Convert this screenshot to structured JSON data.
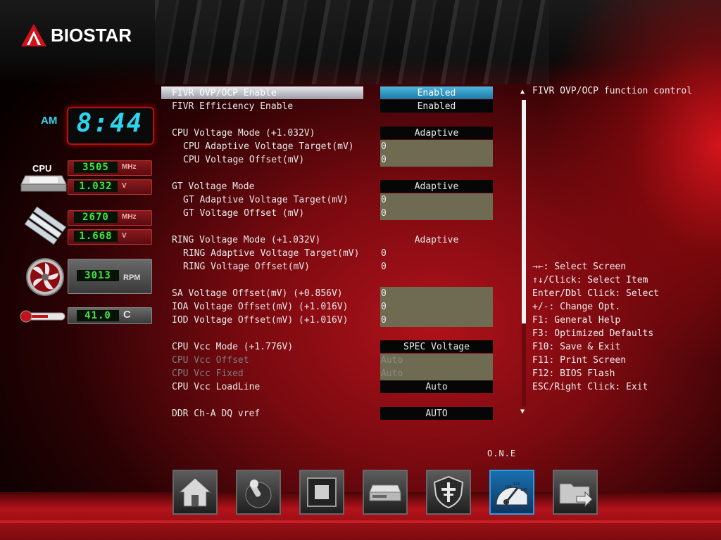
{
  "brand": {
    "name": "BIOSTAR"
  },
  "monitor": {
    "clock": {
      "ampm": "AM",
      "time": "8:44"
    },
    "cpu": {
      "label": "CPU",
      "freq": "3505",
      "freq_unit": "MHz",
      "voltage": "1.032",
      "voltage_unit": "V"
    },
    "memory": {
      "freq": "2670",
      "freq_unit": "MHz",
      "voltage": "1.668",
      "voltage_unit": "V"
    },
    "fan": {
      "speed": "3013",
      "unit": "RPM"
    },
    "temp": {
      "value": "41.0",
      "unit": "C"
    }
  },
  "settings": [
    {
      "label": "FIVR OVP/OCP Enable",
      "value": "Enabled"
    },
    {
      "label": "FIVR Efficiency Enable",
      "value": "Enabled"
    },
    {
      "label": "CPU Voltage Mode (+1.032V)",
      "value": "Adaptive"
    },
    {
      "label": "CPU Adaptive Voltage Target(mV)",
      "value": "0"
    },
    {
      "label": "CPU Voltage Offset(mV)",
      "value": "0"
    },
    {
      "label": "GT Voltage Mode",
      "value": "Adaptive"
    },
    {
      "label": "GT Adaptive Voltage Target(mV)",
      "value": "0"
    },
    {
      "label": "GT Voltage Offset (mV)",
      "value": "0"
    },
    {
      "label": "RING Voltage Mode (+1.032V)",
      "value": "Adaptive"
    },
    {
      "label": "RING Adaptive Voltage Target(mV)",
      "value": "0"
    },
    {
      "label": "RING Voltage Offset(mV)",
      "value": "0"
    },
    {
      "label": "SA Voltage Offset(mV) (+0.856V)",
      "value": "0"
    },
    {
      "label": "IOA Voltage Offset(mV) (+1.016V)",
      "value": "0"
    },
    {
      "label": "IOD Voltage Offset(mV) (+1.016V)",
      "value": "0"
    },
    {
      "label": "CPU Vcc Mode (+1.776V)",
      "value": "SPEC Voltage"
    },
    {
      "label": "CPU Vcc Offset",
      "value": "Auto"
    },
    {
      "label": "CPU Vcc Fixed",
      "value": "Auto"
    },
    {
      "label": "CPU Vcc LoadLine",
      "value": "Auto"
    },
    {
      "label": "DDR Ch-A DQ vref",
      "value": "AUTO"
    }
  ],
  "help": {
    "description": "FIVR OVP/OCP function control",
    "keys": [
      "→←: Select Screen",
      "↑↓/Click: Select Item",
      "Enter/Dbl Click: Select",
      "+/-: Change Opt.",
      "F1: General Help",
      "F3: Optimized Defaults",
      "F10: Save & Exit",
      "F11: Print Screen",
      "F12: BIOS Flash",
      "ESC/Right Click: Exit"
    ]
  },
  "scrollbar": {
    "position_fraction": 0.0,
    "visible_fraction": 0.73
  },
  "nav": {
    "active_label": "O.N.E",
    "items": [
      {
        "icon": "home-icon"
      },
      {
        "icon": "joystick-icon"
      },
      {
        "icon": "chip-icon"
      },
      {
        "icon": "drive-icon"
      },
      {
        "icon": "shield-icon"
      },
      {
        "icon": "gauge-icon"
      },
      {
        "icon": "folder-exit-icon"
      }
    ]
  },
  "colors": {
    "accent": "#1b7aa6",
    "lcd_green": "#3fe83f",
    "clock_cyan": "#2cd6ef",
    "brand_red": "#c4121a"
  }
}
